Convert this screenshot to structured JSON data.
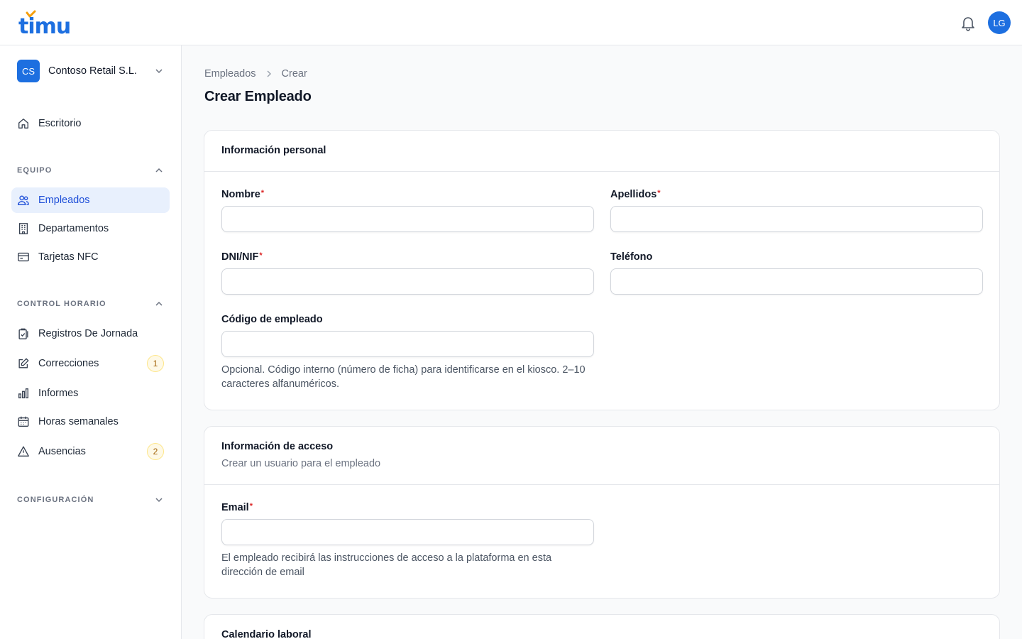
{
  "brand": {
    "name": "timu"
  },
  "header": {
    "avatar_initials": "LG",
    "bell_icon": "bell-icon"
  },
  "org": {
    "initials": "CS",
    "name": "Contoso Retail S.L."
  },
  "sidebar": {
    "home": {
      "label": "Escritorio",
      "icon": "home-icon"
    },
    "sections": [
      {
        "label": "EQUIPO",
        "expanded": true
      },
      {
        "label": "CONTROL HORARIO",
        "expanded": true
      },
      {
        "label": "CONFIGURACIÓN",
        "expanded": false
      }
    ],
    "equipo_items": [
      {
        "label": "Empleados",
        "icon": "users-icon",
        "active": true
      },
      {
        "label": "Departamentos",
        "icon": "building-icon"
      },
      {
        "label": "Tarjetas NFC",
        "icon": "credit-card-icon"
      }
    ],
    "control_items": [
      {
        "label": "Registros De Jornada",
        "icon": "clipboard-check-icon"
      },
      {
        "label": "Correcciones",
        "icon": "pencil-square-icon",
        "badge": "1"
      },
      {
        "label": "Informes",
        "icon": "bar-chart-icon"
      },
      {
        "label": "Horas semanales",
        "icon": "calendar-icon"
      },
      {
        "label": "Ausencias",
        "icon": "warning-triangle-icon",
        "badge": "2"
      }
    ]
  },
  "breadcrumb": {
    "parent": "Empleados",
    "current": "Crear"
  },
  "page": {
    "title": "Crear Empleado"
  },
  "personal": {
    "title": "Información personal",
    "nombre": {
      "label": "Nombre",
      "value": "",
      "required": true
    },
    "apellidos": {
      "label": "Apellidos",
      "value": "",
      "required": true
    },
    "dni": {
      "label": "DNI/NIF",
      "value": "",
      "required": true
    },
    "telefono": {
      "label": "Teléfono",
      "value": ""
    },
    "codigo": {
      "label": "Código de empleado",
      "value": "",
      "hint": "Opcional. Código interno (número de ficha) para identificarse en el kiosco. 2–10 caracteres alfanuméricos."
    }
  },
  "acceso": {
    "title": "Información de acceso",
    "subtitle": "Crear un usuario para el empleado",
    "email": {
      "label": "Email",
      "value": "",
      "required": true,
      "hint": "El empleado recibirá las instrucciones de acceso a la plataforma en esta dirección de email"
    }
  },
  "calendario": {
    "title": "Calendario laboral"
  },
  "colors": {
    "primary": "#1d6fe0",
    "logo_accent": "#f59e0b",
    "active_bg": "#e8f0fd",
    "required": "#dc2626"
  }
}
